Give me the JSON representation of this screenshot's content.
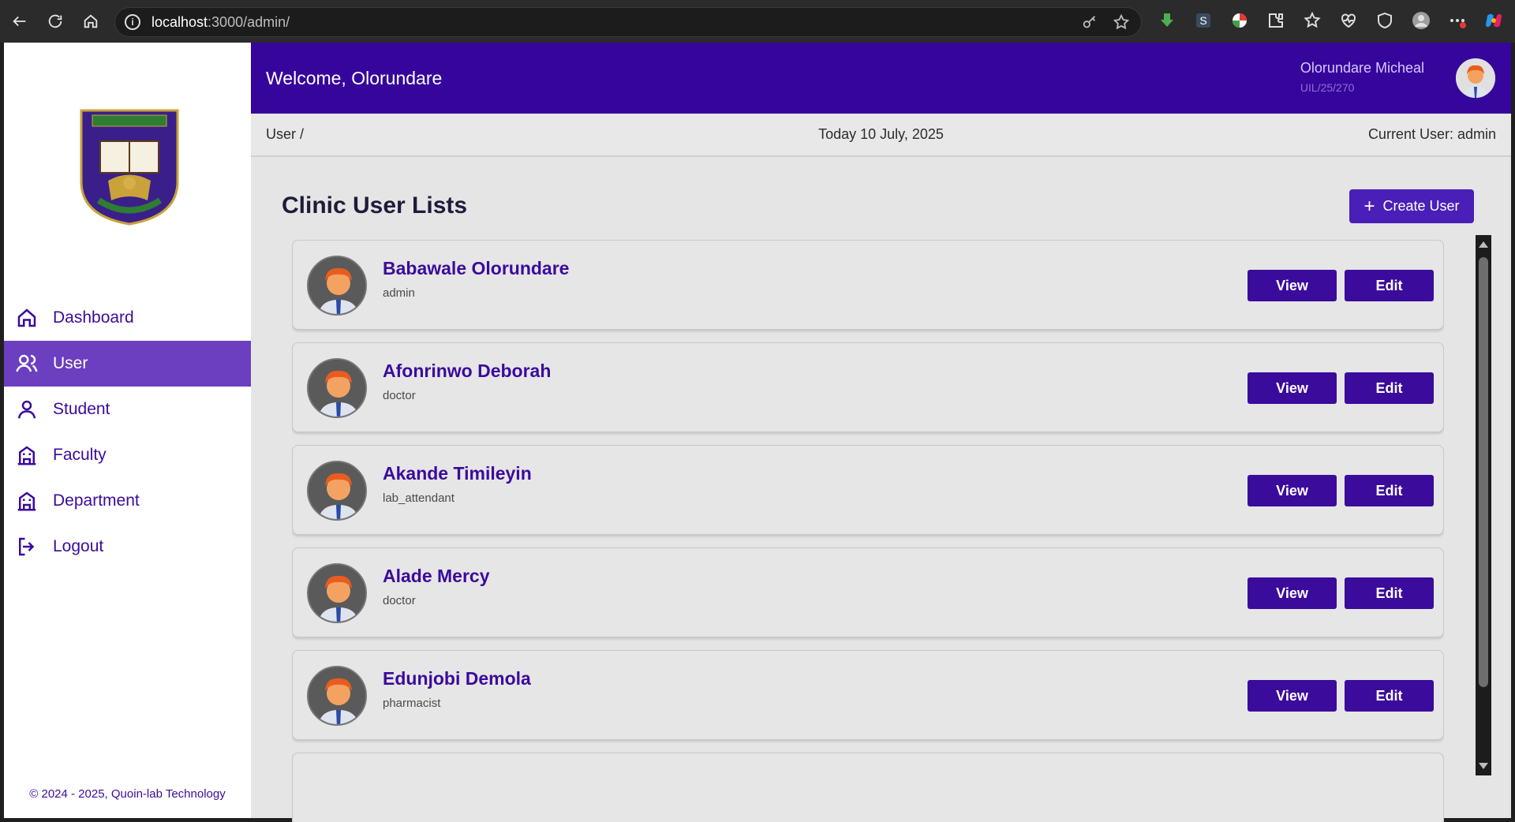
{
  "browser": {
    "url_host": "localhost",
    "url_rest": ":3000/admin/"
  },
  "header": {
    "welcome": "Welcome, Olorundare",
    "user_name": "Olorundare Micheal",
    "user_id": "UIL/25/270"
  },
  "subbar": {
    "breadcrumb": "User /",
    "date": "Today 10 July, 2025",
    "current_user": "Current User: admin"
  },
  "sidebar": {
    "items": [
      {
        "label": "Dashboard",
        "icon": "home-icon"
      },
      {
        "label": "User",
        "icon": "users-icon",
        "active": true
      },
      {
        "label": "Student",
        "icon": "person-icon"
      },
      {
        "label": "Faculty",
        "icon": "building-icon"
      },
      {
        "label": "Department",
        "icon": "building-icon"
      },
      {
        "label": "Logout",
        "icon": "logout-icon"
      }
    ],
    "copyright": "© 2024 - 2025, Quoin-lab Technology"
  },
  "main": {
    "title": "Clinic User Lists",
    "create_label": "Create User",
    "view_label": "View",
    "edit_label": "Edit",
    "users": [
      {
        "name": "Babawale Olorundare",
        "role": "admin"
      },
      {
        "name": "Afonrinwo Deborah",
        "role": "doctor"
      },
      {
        "name": "Akande Timileyin",
        "role": "lab_attendant"
      },
      {
        "name": "Alade Mercy",
        "role": "doctor"
      },
      {
        "name": "Edunjobi Demola",
        "role": "pharmacist"
      }
    ]
  },
  "colors": {
    "primary": "#3b0b9c",
    "topbar": "#36069c",
    "active_nav": "#6b3fbf"
  }
}
